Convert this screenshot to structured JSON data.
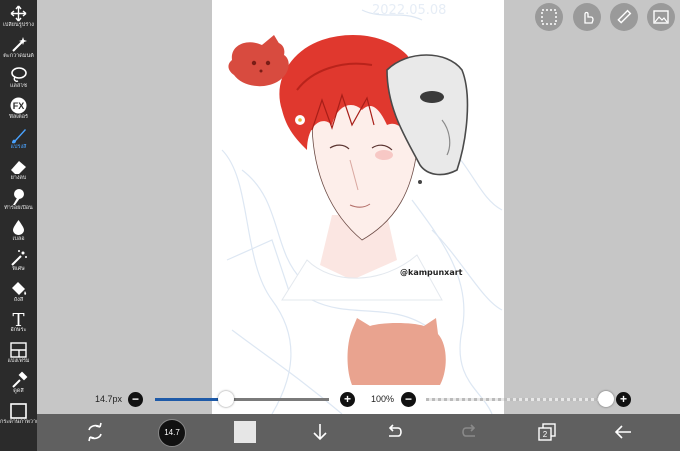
{
  "toolbar": {
    "tools": [
      {
        "label": "เปลี่ยนรูปร่าง",
        "icon": "move-icon"
      },
      {
        "label": "ตะกวาดมนต์",
        "icon": "magic-wand-icon"
      },
      {
        "label": "แลสโซ",
        "icon": "lasso-icon"
      },
      {
        "label": "ฟิลเตอร์",
        "icon": "fx-icon"
      },
      {
        "label": "แปรงสี",
        "icon": "brush-icon"
      },
      {
        "label": "ยางลบ",
        "icon": "eraser-icon"
      },
      {
        "label": "ทำรอยเปื้อน",
        "icon": "smudge-icon"
      },
      {
        "label": "เบลอ",
        "icon": "blur-drop-icon"
      },
      {
        "label": "พิเศษ",
        "icon": "special-wand-icon"
      },
      {
        "label": "ถังสี",
        "icon": "bucket-icon"
      },
      {
        "label": "อักษระ",
        "icon": "text-icon"
      },
      {
        "label": "แบ่งเฟรม",
        "icon": "frame-divider-icon"
      },
      {
        "label": "ดูดสี",
        "icon": "eyedropper-icon"
      },
      {
        "label": "กระดาษภาพวาด",
        "icon": "canvas-icon"
      }
    ]
  },
  "canvas": {
    "watermark": "@kampunxart",
    "date_sketch": "2022.05.08"
  },
  "sliders": {
    "brush_size_label": "14.7px",
    "brush_size_value": 0.41,
    "opacity_label": "100%",
    "opacity_value": 1.0
  },
  "bottom": {
    "brush_size_badge": "14.7",
    "layer_count": "2"
  },
  "colors": {
    "toolbar_bg": "#2b2b2b",
    "active_tool": "#4aa3ff",
    "slider_fill": "#1e5aa8",
    "bottom_bg": "#606060",
    "hair_red": "#e0382e"
  }
}
